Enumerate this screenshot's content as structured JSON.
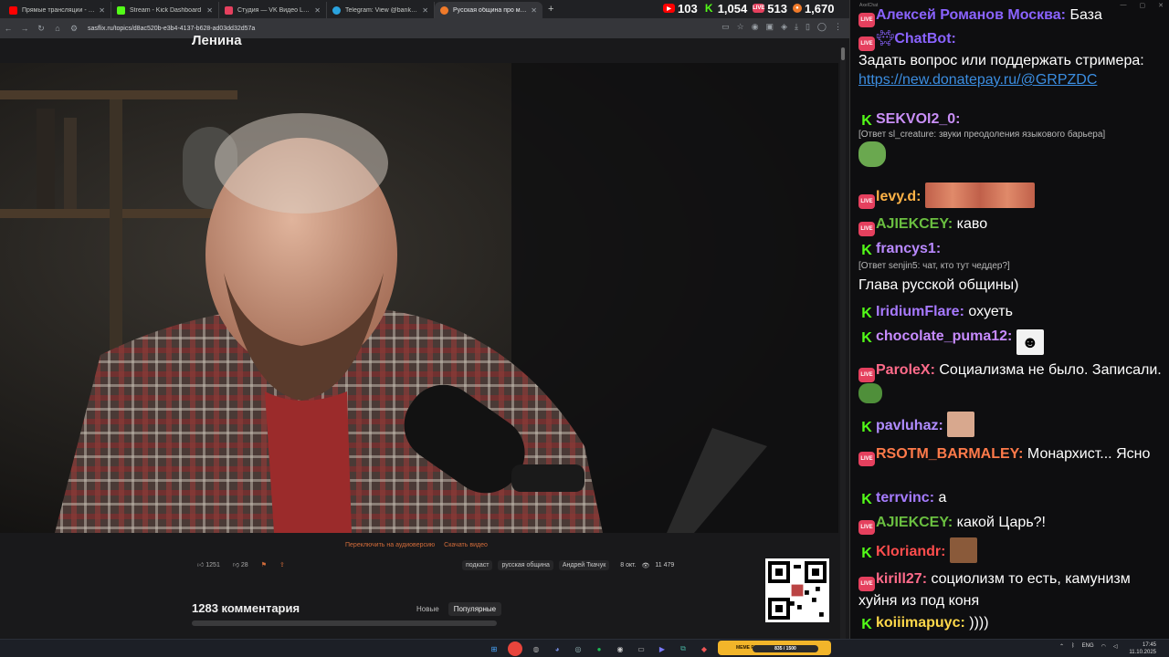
{
  "browser": {
    "tabs": [
      {
        "label": "Прямые трансляции - YouTube",
        "color": "#ff0000"
      },
      {
        "label": "Stream - Kick Dashboard",
        "color": "#53fc18"
      },
      {
        "label": "Студия — VK Видео Live",
        "color": "#e5405e"
      },
      {
        "label": "Telegram: View @banksta",
        "color": "#2aa3de"
      },
      {
        "label": "Русская община про мигр...",
        "color": "#f07a2a"
      }
    ],
    "url": "sasflix.ru/topics/d8ac520b-e3b4-4137-b628-ad03dd32d57a"
  },
  "stats": {
    "youtube": "103",
    "kick": "1,054",
    "vk": "513",
    "total": "1,670"
  },
  "page": {
    "title": "Ленина",
    "switch_audio": "Переключить на аудиоверсию",
    "download": "Скачать видео",
    "likes": "1251",
    "dislikes": "28",
    "tags": [
      "подкаст",
      "русская община",
      "Андрей Ткачук"
    ],
    "date": "8 окт.",
    "views": "11 479",
    "comments_title": "1283 комментария",
    "sort_new": "Новые",
    "sort_popular": "Популярные"
  },
  "chat": {
    "title": "AxelChat",
    "messages": [
      {
        "platform": "vk",
        "user": "Алексей Романов Москва:",
        "color": "#8a63ff",
        "text": " База"
      },
      {
        "platform": "vk",
        "user": "ChatBot:",
        "color": "#8a63ff",
        "text": "Задать вопрос или поддержать стримера:",
        "link": "https://new.donatepay.ru/@GRPZDC"
      },
      {
        "platform": "kick",
        "user": "SEKVOI2_0:",
        "color": "#c98ff7",
        "reply": "[Ответ sl_creature: звуки преодоления языкового барьера]"
      },
      {
        "platform": "vk",
        "user": "levy.d:",
        "color": "#ffb347",
        "text": ""
      },
      {
        "platform": "vk",
        "user": "AJIEKCEY:",
        "color": "#6abf40",
        "text": " каво"
      },
      {
        "platform": "kick",
        "user": "francys1:",
        "color": "#b989ff",
        "reply": "[Ответ senjin5: чат, кто тут чеддер?]",
        "text": "Глава русской общины)"
      },
      {
        "platform": "kick",
        "user": "IridiumFlare:",
        "color": "#a779ff",
        "text": " охуеть"
      },
      {
        "platform": "kick",
        "user": "chocolate_puma12:",
        "color": "#c78bff",
        "text": ""
      },
      {
        "platform": "vk",
        "user": "ParoleX:",
        "color": "#ff6b8a",
        "text": " Социализма не было. Записали."
      },
      {
        "platform": "kick",
        "user": "pavluhaz:",
        "color": "#b08cff",
        "text": ""
      },
      {
        "platform": "vk",
        "user": "RSOTM_BARMALEY:",
        "color": "#ff7a4a",
        "text": " Монархист... Ясно"
      },
      {
        "platform": "kick",
        "user": "terrvinc:",
        "color": "#a67cff",
        "text": " а"
      },
      {
        "platform": "vk",
        "user": "AJIEKCEY:",
        "color": "#6abf40",
        "text": " какой Царь?!"
      },
      {
        "platform": "kick",
        "user": "Kloriandr:",
        "color": "#ff4d4d",
        "text": ""
      },
      {
        "platform": "vk",
        "user": "kirill27:",
        "color": "#ff6b8a",
        "text": " социолизм то есть, камунизм хуйня из под коня"
      },
      {
        "platform": "kick",
        "user": "koiiimapuyc:",
        "color": "#ffd84a",
        "text": " ))))"
      }
    ]
  },
  "taskbar": {
    "meme_label": "MEME PARTY",
    "meme_progress": "835 / 1500",
    "lang": "ENG",
    "time": "17:45",
    "date": "11.10.2025"
  }
}
